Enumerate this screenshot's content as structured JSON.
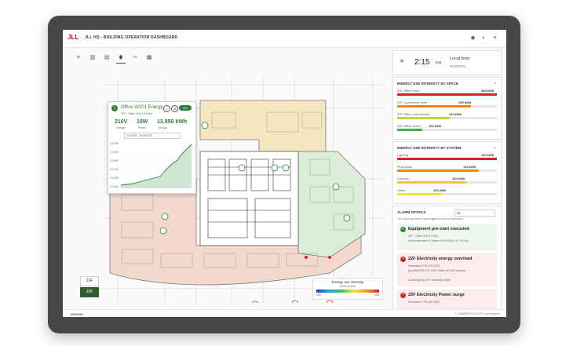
{
  "app": {
    "logo": "JLL",
    "title": "JLL HQ - BUILDING OPERATION DASHBOARD",
    "header_icons": [
      "pin-icon",
      "contrast-icon",
      "menu-icon"
    ]
  },
  "toolbar": {
    "tools": [
      {
        "name": "list-view-icon",
        "glyph": "≡"
      },
      {
        "name": "bar-chart-icon",
        "glyph": "▥"
      },
      {
        "name": "table-icon",
        "glyph": "▤"
      },
      {
        "name": "location-pin-icon",
        "glyph": "⬮"
      },
      {
        "name": "line-chart-icon",
        "glyph": "〜"
      },
      {
        "name": "grid-icon",
        "glyph": "▦"
      }
    ]
  },
  "floors": [
    "23F",
    "22F"
  ],
  "selected_floor": "22F",
  "tooltip": {
    "number": "1",
    "title": "Office W101 Energy",
    "subtitle": "22F / Office W101 (North)",
    "toggle": "ON",
    "metrics": [
      {
        "value": "210V",
        "label": "Voltage"
      },
      {
        "value": "10W",
        "label": "Power"
      },
      {
        "value": "13,950 kWh",
        "label": "Energy"
      }
    ],
    "date_range": "1/1/2023 - 9/20/2023",
    "chart": {
      "y_ticks": [
        "14,000",
        "13,800",
        "13,600",
        "13,400",
        "13,200",
        "13,000"
      ]
    }
  },
  "time_card": {
    "time": "2:15",
    "ampm": "PM",
    "label": "Local time",
    "date": "9/20/2023"
  },
  "space_card": {
    "title": "ENERGY USE INTENSITY BY SPACE",
    "items": [
      {
        "label": "22F Office zone",
        "value": "394 kWh",
        "fraction": 1.0,
        "color": "#d0202a"
      },
      {
        "label": "22F Conference zone",
        "value": "290 kWh",
        "fraction": 0.74,
        "color": "#e8862a"
      },
      {
        "label": "22F Office zone (North)",
        "value": "210 kWh",
        "fraction": 0.53,
        "color": "#b8d84a"
      },
      {
        "label": "22F Office (Core)",
        "value": "100 kWh",
        "fraction": 0.25,
        "color": "#3cb84a"
      }
    ]
  },
  "system_card": {
    "title": "ENERGY USE INTENSITY BY SYSTEM",
    "items": [
      {
        "label": "Lighting",
        "value": "160 kWh",
        "fraction": 1.0,
        "color": "#d0202a"
      },
      {
        "label": "Plug loads",
        "value": "142 kWh",
        "fraction": 0.82,
        "color": "#e8862a"
      },
      {
        "label": "Controls",
        "value": "120 kWh",
        "fraction": 0.69,
        "color": "#f2c43c"
      },
      {
        "label": "Other",
        "value": "100 kWh",
        "fraction": 0.45,
        "color": "#f4e03c"
      }
    ]
  },
  "alarms": {
    "title": "ALARM DETAILS",
    "filter": "All",
    "subtitle": "The following events were triggered and not dismissed",
    "items": [
      {
        "type": "ok",
        "title": "Equipment pre-start executed",
        "lines": [
          "22F - Office W101 HVAC",
          "Scheduled start of Office W101 HVAC at 7:30 AM"
        ],
        "bg": "#eef7ee",
        "icon_color": "#2f8a3a"
      },
      {
        "type": "error",
        "title": "22F Electricity energy overload",
        "lines": [
          "Substation: PW-22F-0302",
          "[ALARM] PW-22F-0302 Office W1 kW overload",
          "Control group 22F electricity meter"
        ],
        "bg": "#fdecec",
        "icon_color": "#d0202a"
      },
      {
        "type": "error",
        "title": "22F Electricity Power surge",
        "lines": [
          "Substation: PW-22F-0302"
        ],
        "bg": "#fdecec",
        "icon_color": "#d0202a"
      }
    ]
  },
  "legend": {
    "title": "Energy use intensity",
    "subtitle": "kWh/m2/year",
    "min": "100",
    "max": "400"
  },
  "footer": {
    "left": "DESIGN",
    "right": "© CAMMERON 2023 © Lorem ipsum"
  }
}
